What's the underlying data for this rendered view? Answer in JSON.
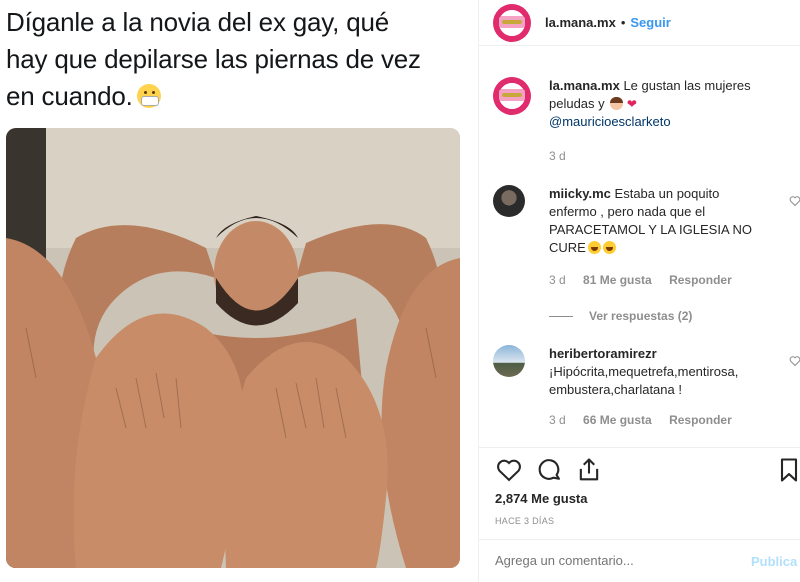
{
  "post": {
    "caption_lines": [
      "Díganle a la novia del ex gay, qué",
      "hay que depilarse las piernas de vez",
      "en cuando."
    ],
    "caption_emoji": "face-with-medical-mask"
  },
  "header": {
    "username": "la.mana.mx",
    "separator": "•",
    "follow_label": "Seguir"
  },
  "comments": [
    {
      "username": "la.mana.mx",
      "text_line1": "Le gustan las mujeres",
      "text_line2": "peludas y",
      "mention": "@mauricioesclarketo",
      "time": "3 d"
    },
    {
      "username": "miicky.mc",
      "text_line1": "Estaba un poquito",
      "text_line2": "enfermo , pero nada que el",
      "text_line3": "PARACETAMOL Y LA IGLESIA NO",
      "text_line4": "CURE",
      "time": "3 d",
      "likes": "81 Me gusta",
      "reply": "Responder"
    },
    {
      "username": "heribertoramirezr",
      "text_line1": "¡Hipócrita,mequetrefa,mentirosa,",
      "text_line2": "embustera,charlatana !",
      "time": "3 d",
      "likes": "66 Me gusta",
      "reply": "Responder"
    }
  ],
  "view_replies": "Ver respuestas (2)",
  "actions": {
    "likes": "2,874 Me gusta",
    "date": "HACE 3 DÍAS"
  },
  "add_comment": {
    "placeholder": "Agrega un comentario...",
    "publish_label": "Publica"
  },
  "colors": {
    "link_blue": "#3897f0",
    "mention_blue": "#003569",
    "muted_gray": "#8e8e8e",
    "brand_pink": "#e02c6d"
  }
}
